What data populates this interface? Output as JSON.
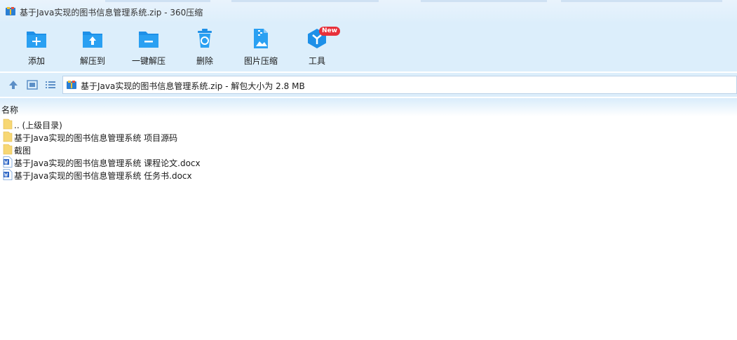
{
  "window": {
    "title": "基于Java实现的图书信息管理系统.zip - 360压缩",
    "icon": "archive-icon"
  },
  "toolbar": {
    "buttons": [
      {
        "id": "add",
        "label": "添加",
        "icon": "folder-plus-icon"
      },
      {
        "id": "extract-to",
        "label": "解压到",
        "icon": "folder-upload-icon"
      },
      {
        "id": "one-click-extract",
        "label": "一键解压",
        "icon": "folder-minus-icon"
      },
      {
        "id": "delete",
        "label": "删除",
        "icon": "recycle-bin-icon"
      },
      {
        "id": "image-compress",
        "label": "图片压缩",
        "icon": "zip-image-icon"
      },
      {
        "id": "tools",
        "label": "工具",
        "icon": "tools-hexagon-icon",
        "badge": "New"
      }
    ]
  },
  "addressbar": {
    "path": "基于Java实现的图书信息管理系统.zip - 解包大小为 2.8 MB"
  },
  "list": {
    "column_name": "名称",
    "items": [
      {
        "name": ".. (上级目录)",
        "type": "folder"
      },
      {
        "name": "基于Java实现的图书信息管理系统 项目源码",
        "type": "folder"
      },
      {
        "name": "截图",
        "type": "folder"
      },
      {
        "name": "基于Java实现的图书信息管理系统 课程论文.docx",
        "type": "docx"
      },
      {
        "name": "基于Java实现的图书信息管理系统 任务书.docx",
        "type": "docx"
      }
    ]
  },
  "colors": {
    "accent": "#1e90e8",
    "toolbar_bg": "#dceefb",
    "badge": "#e8303a"
  }
}
